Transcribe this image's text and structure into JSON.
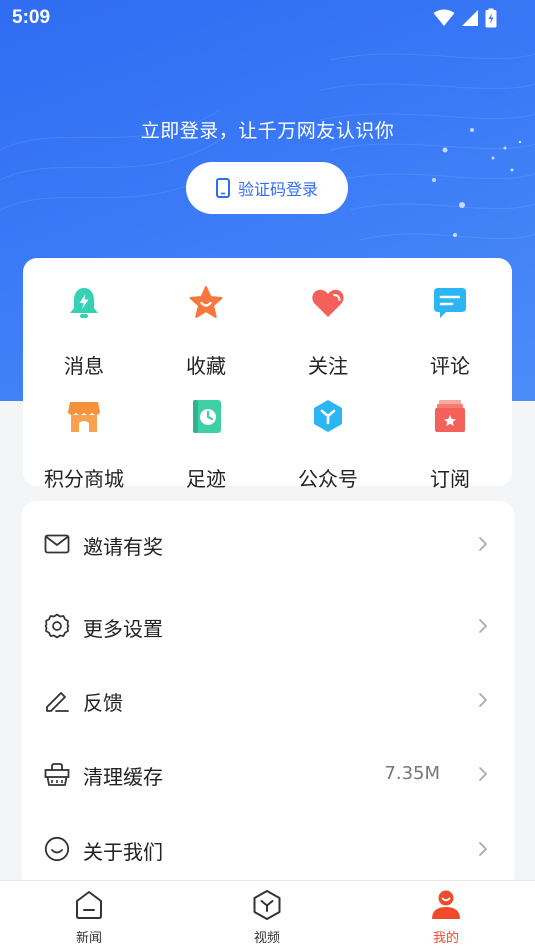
{
  "status_bar": {
    "time": "5:09"
  },
  "header": {
    "login_prompt": "立即登录，让千万网友认识你",
    "login_button_label": "验证码登录"
  },
  "grid": [
    {
      "key": "message",
      "label": "消息",
      "icon": "bell-icon"
    },
    {
      "key": "favorite",
      "label": "收藏",
      "icon": "star-icon"
    },
    {
      "key": "follow",
      "label": "关注",
      "icon": "heart-icon"
    },
    {
      "key": "comment",
      "label": "评论",
      "icon": "chat-icon"
    },
    {
      "key": "points-mall",
      "label": "积分商城",
      "icon": "shop-icon"
    },
    {
      "key": "history",
      "label": "足迹",
      "icon": "clock-book-icon"
    },
    {
      "key": "official-accounts",
      "label": "公众号",
      "icon": "hexagon-icon"
    },
    {
      "key": "subscribe",
      "label": "订阅",
      "icon": "ribbon-box-icon"
    }
  ],
  "menu": [
    {
      "key": "invite",
      "label": "邀请有奖",
      "icon": "mail-icon",
      "value": ""
    },
    {
      "key": "settings",
      "label": "更多设置",
      "icon": "gear-icon",
      "value": ""
    },
    {
      "key": "feedback",
      "label": "反馈",
      "icon": "pencil-icon",
      "value": ""
    },
    {
      "key": "clear-cache",
      "label": "清理缓存",
      "icon": "basket-icon",
      "value": "7.35M"
    },
    {
      "key": "about",
      "label": "关于我们",
      "icon": "smile-icon",
      "value": ""
    }
  ],
  "tabs": [
    {
      "key": "news",
      "label": "新闻",
      "icon": "home-icon",
      "active": false
    },
    {
      "key": "video",
      "label": "视频",
      "icon": "video-hexagon-icon",
      "active": false
    },
    {
      "key": "mine",
      "label": "我的",
      "icon": "user-icon",
      "active": true
    }
  ],
  "colors": {
    "header_blue": "#2f6cf2",
    "active_tab": "#ef4a2c",
    "page_background": "#f4f5f7"
  }
}
